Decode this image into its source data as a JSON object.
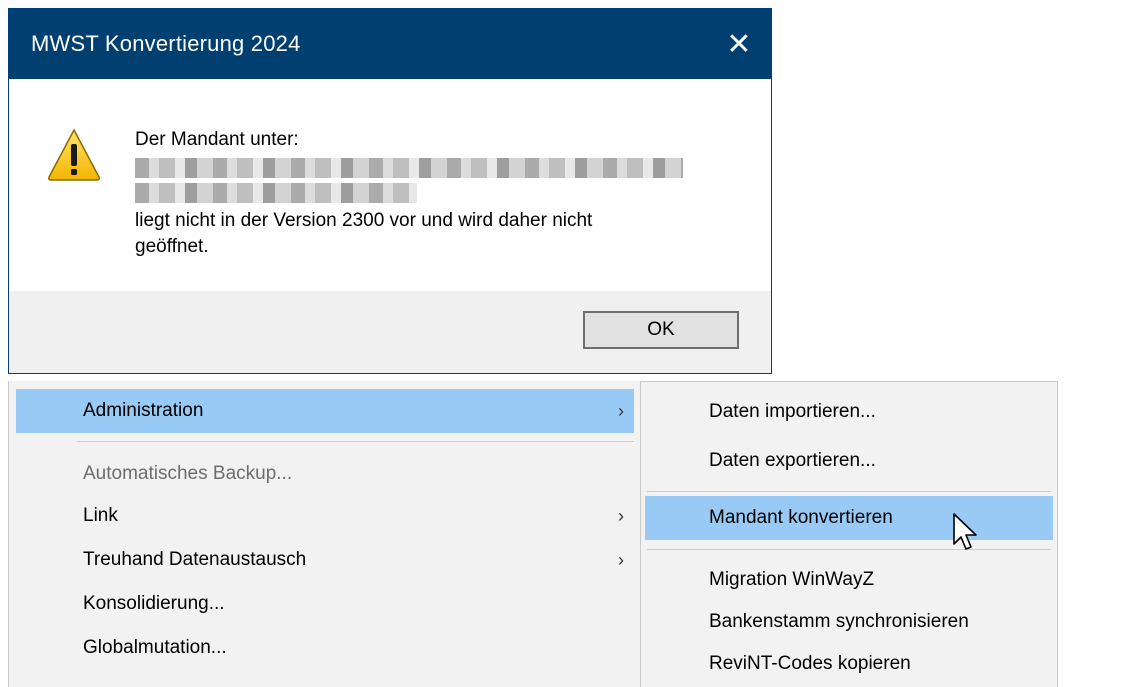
{
  "dialog": {
    "title": "MWST Konvertierung 2024",
    "close_glyph": "✕",
    "icon": "warning-icon",
    "message_intro": "Der Mandant unter:",
    "message_line1": "liegt nicht in der Version 2300 vor und wird daher nicht",
    "message_line2": "geöffnet.",
    "ok_label": "OK"
  },
  "menu": {
    "items": [
      {
        "label": "Administration",
        "arrow": "›"
      },
      {
        "label": "Automatisches Backup..."
      },
      {
        "label": "Link",
        "arrow": "›"
      },
      {
        "label": "Treuhand Datenaustausch",
        "arrow": "›"
      },
      {
        "label": "Konsolidierung..."
      },
      {
        "label": "Globalmutation..."
      }
    ]
  },
  "submenu": {
    "items": [
      {
        "label": "Daten importieren..."
      },
      {
        "label": "Daten exportieren..."
      },
      {
        "label": "Mandant konvertieren"
      },
      {
        "label": "Migration WinWayZ"
      },
      {
        "label": "Bankenstamm synchronisieren"
      },
      {
        "label": "ReviNT-Codes kopieren"
      }
    ]
  },
  "colors": {
    "titlebar": "#003f70",
    "highlight": "#99c9f5",
    "menu_bg": "#f2f2f2"
  }
}
